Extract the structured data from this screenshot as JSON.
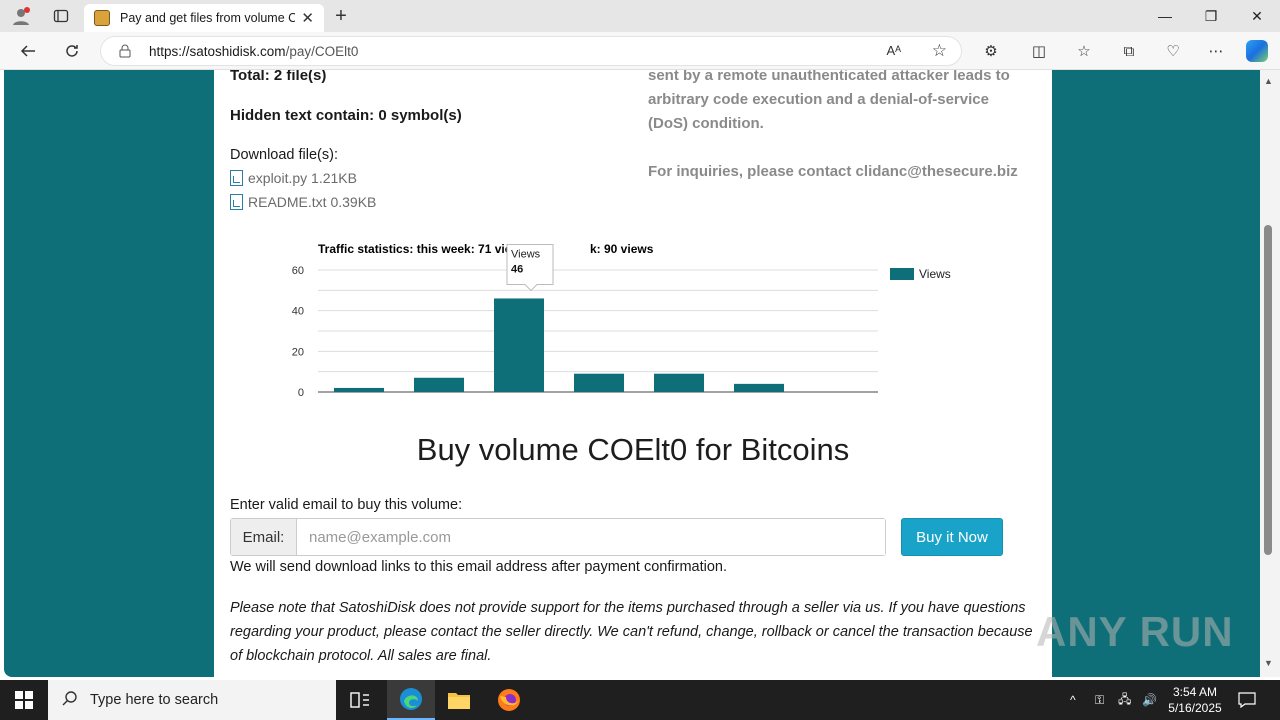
{
  "browser": {
    "tab_title": "Pay and get files from volume CO",
    "url_host": "https://satoshidisk.com",
    "url_path": "/pay/COElt0"
  },
  "page": {
    "total_files": "Total: 2 file(s)",
    "hidden_text": "Hidden text contain: 0 symbol(s)",
    "download_label": "Download file(s):",
    "files": [
      {
        "name": "exploit.py",
        "size": "1.21KB"
      },
      {
        "name": "README.txt",
        "size": "0.39KB"
      }
    ],
    "description_lines": [
      "sent by a remote unauthenticated attacker leads to",
      "arbitrary code execution and a denial-of-service",
      "(DoS) condition."
    ],
    "inquiries": "For inquiries, please contact clidanc@thesecure.biz",
    "buy_title": "Buy volume COElt0 for Bitcoins",
    "email_prompt": "Enter valid email to buy this volume:",
    "email_addon": "Email:",
    "email_placeholder": "name@example.com",
    "buy_button": "Buy it Now",
    "email_note": "We will send download links to this email address after payment confirmation.",
    "disclaimer": "Please note that SatoshiDisk does not provide support for the items purchased through a seller via us. If you have questions regarding your product, please contact the seller directly. We can't refund, change, rollback or cancel the transaction because of blockchain protocol. All sales are final."
  },
  "chart_data": {
    "type": "bar",
    "title": "Traffic statistics: this week: 71 views;",
    "title_tail": "k: 90 views",
    "series": [
      {
        "name": "Views",
        "values": [
          2,
          7,
          46,
          9,
          9,
          4
        ],
        "color": "#0e6f79"
      }
    ],
    "ylim": [
      0,
      60
    ],
    "yticks": [
      "0",
      "20",
      "40",
      "60"
    ],
    "grid": true,
    "legend": "top-right",
    "tooltip": {
      "label": "Views",
      "value": "46"
    }
  },
  "watermark": "ANY RUN",
  "taskbar": {
    "search_placeholder": "Type here to search",
    "time": "3:54 AM",
    "date": "5/16/2025"
  }
}
